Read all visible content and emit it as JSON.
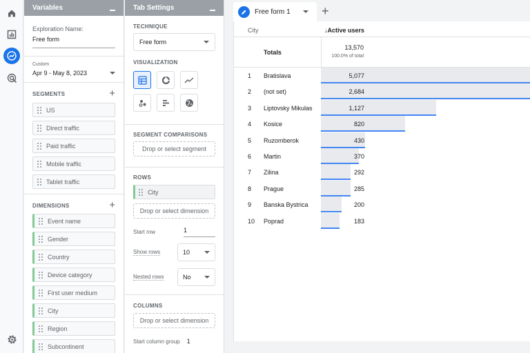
{
  "nav": {
    "icons": [
      "home-icon",
      "reports-icon",
      "explore-icon",
      "advertising-icon",
      "settings-icon"
    ]
  },
  "variables": {
    "title": "Variables",
    "exploration_label": "Exploration Name:",
    "exploration_name": "Free form",
    "date_type": "Custom",
    "date_range": "Apr 9 - May 8, 2023",
    "segments_title": "SEGMENTS",
    "segments": [
      "US",
      "Direct traffic",
      "Paid traffic",
      "Mobile traffic",
      "Tablet traffic"
    ],
    "dimensions_title": "DIMENSIONS",
    "dimensions": [
      "Event name",
      "Gender",
      "Country",
      "Device category",
      "First user medium",
      "City",
      "Region",
      "Subcontinent"
    ]
  },
  "tab_settings": {
    "title": "Tab Settings",
    "technique_title": "TECHNIQUE",
    "technique_value": "Free form",
    "visualization_title": "VISUALIZATION",
    "segment_comparisons_title": "SEGMENT COMPARISONS",
    "segment_drop": "Drop or select segment",
    "rows_title": "ROWS",
    "row_dimension": "City",
    "dimension_drop": "Drop or select dimension",
    "start_row_label": "Start row",
    "start_row_value": "1",
    "show_rows_label": "Show rows",
    "show_rows_value": "10",
    "nested_rows_label": "Nested rows",
    "nested_rows_value": "No",
    "columns_title": "COLUMNS",
    "columns_drop": "Drop or select dimension",
    "start_column_label": "Start column group",
    "start_column_value": "1"
  },
  "canvas": {
    "tab_name": "Free form 1",
    "col_city": "City",
    "col_users": "↓Active users",
    "totals_label": "Totals",
    "totals_value": "13,570",
    "totals_pct": "100.0% of total",
    "rows": [
      {
        "idx": "1",
        "city": "Bratislava",
        "users": "5,077",
        "share": 1.0
      },
      {
        "idx": "2",
        "city": "(not set)",
        "users": "2,684",
        "share": 1.0
      },
      {
        "idx": "3",
        "city": "Liptovsky Mikulas",
        "users": "1,127",
        "share": 0.55
      },
      {
        "idx": "4",
        "city": "Kosice",
        "users": "820",
        "share": 0.4
      },
      {
        "idx": "5",
        "city": "Ruzomberok",
        "users": "430",
        "share": 0.21
      },
      {
        "idx": "6",
        "city": "Martin",
        "users": "370",
        "share": 0.18
      },
      {
        "idx": "7",
        "city": "Zilina",
        "users": "292",
        "share": 0.14
      },
      {
        "idx": "8",
        "city": "Prague",
        "users": "285",
        "share": 0.14
      },
      {
        "idx": "9",
        "city": "Banska Bystrica",
        "users": "200",
        "share": 0.1
      },
      {
        "idx": "10",
        "city": "Poprad",
        "users": "183",
        "share": 0.09
      }
    ]
  },
  "colors": {
    "accent": "#1a73e8",
    "bar_line": "#4285f4",
    "dimension_marker": "#81c995"
  }
}
